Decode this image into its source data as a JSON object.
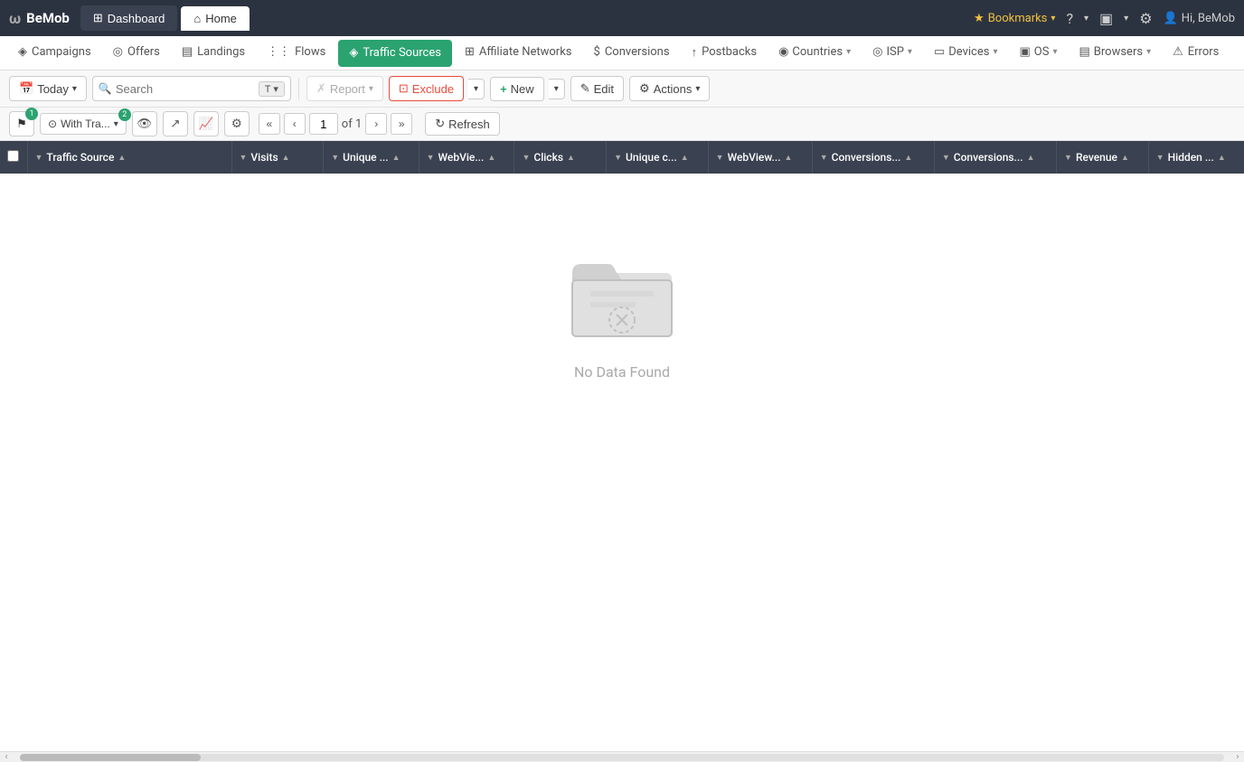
{
  "app": {
    "logo": "BeMob",
    "logo_icon": "ω"
  },
  "top_nav": {
    "tabs": [
      {
        "id": "dashboard",
        "label": "Dashboard",
        "active": false,
        "icon": "⊞"
      },
      {
        "id": "home",
        "label": "Home",
        "active": true,
        "icon": "⌂"
      }
    ],
    "right": {
      "bookmarks": "Bookmarks",
      "help_icon": "?",
      "monitor_icon": "▣",
      "settings_icon": "⚙",
      "user": "Hi, BeMob"
    }
  },
  "main_nav": {
    "items": [
      {
        "id": "campaigns",
        "label": "Campaigns",
        "icon": "◈",
        "active": false,
        "has_arrow": false
      },
      {
        "id": "offers",
        "label": "Offers",
        "icon": "◎",
        "active": false,
        "has_arrow": false
      },
      {
        "id": "landings",
        "label": "Landings",
        "icon": "▤",
        "active": false,
        "has_arrow": false
      },
      {
        "id": "flows",
        "label": "Flows",
        "icon": "⋮⋮",
        "active": false,
        "has_arrow": false
      },
      {
        "id": "traffic-sources",
        "label": "Traffic Sources",
        "icon": "◈",
        "active": true,
        "has_arrow": false
      },
      {
        "id": "affiliate-networks",
        "label": "Affiliate Networks",
        "icon": "⊞",
        "active": false,
        "has_arrow": false
      },
      {
        "id": "conversions",
        "label": "Conversions",
        "icon": "$",
        "active": false,
        "has_arrow": false
      },
      {
        "id": "postbacks",
        "label": "Postbacks",
        "icon": "↑",
        "active": false,
        "has_arrow": false
      },
      {
        "id": "countries",
        "label": "Countries",
        "icon": "◉",
        "active": false,
        "has_arrow": true
      },
      {
        "id": "isp",
        "label": "ISP",
        "icon": "◎",
        "active": false,
        "has_arrow": true
      },
      {
        "id": "devices",
        "label": "Devices",
        "icon": "▭",
        "active": false,
        "has_arrow": true
      },
      {
        "id": "os",
        "label": "OS",
        "icon": "▣",
        "active": false,
        "has_arrow": true
      },
      {
        "id": "browsers",
        "label": "Browsers",
        "icon": "▤",
        "active": false,
        "has_arrow": true
      },
      {
        "id": "errors",
        "label": "Errors",
        "icon": "⚠",
        "active": false,
        "has_arrow": false
      }
    ]
  },
  "toolbar": {
    "today_label": "Today",
    "search_placeholder": "Search",
    "search_type": "T",
    "report_label": "Report",
    "exclude_label": "Exclude",
    "new_label": "New",
    "edit_label": "Edit",
    "actions_label": "Actions"
  },
  "toolbar2": {
    "flag_badge": "1",
    "with_tra_label": "With Tra...",
    "with_tra_badge": "2",
    "page_current": "1",
    "page_of": "of 1",
    "refresh_label": "Refresh"
  },
  "table": {
    "columns": [
      {
        "id": "source",
        "label": "Traffic Source"
      },
      {
        "id": "visits",
        "label": "Visits"
      },
      {
        "id": "unique_v",
        "label": "Unique ..."
      },
      {
        "id": "webview",
        "label": "WebVie..."
      },
      {
        "id": "clicks",
        "label": "Clicks"
      },
      {
        "id": "unique_c",
        "label": "Unique c..."
      },
      {
        "id": "webview2",
        "label": "WebView..."
      },
      {
        "id": "conversions1",
        "label": "Conversions..."
      },
      {
        "id": "conversions2",
        "label": "Conversions..."
      },
      {
        "id": "revenue",
        "label": "Revenue"
      },
      {
        "id": "hidden",
        "label": "Hidden ..."
      }
    ],
    "rows": []
  },
  "empty_state": {
    "text": "No Data Found"
  }
}
